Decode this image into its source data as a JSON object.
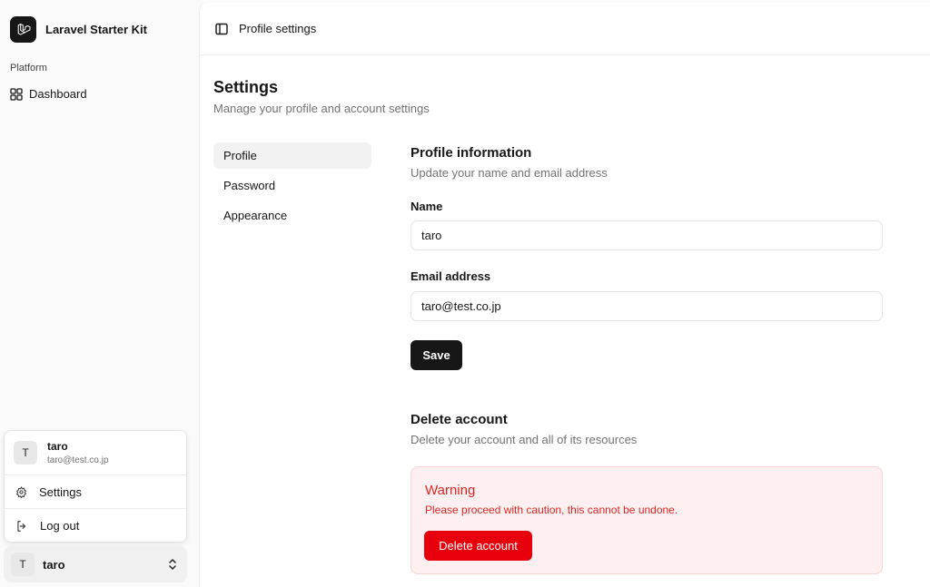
{
  "sidebar": {
    "brand": "Laravel Starter Kit",
    "group_label": "Platform",
    "nav": [
      {
        "label": "Dashboard",
        "icon": "layout-grid-icon"
      }
    ]
  },
  "user_menu": {
    "avatar_initial": "T",
    "name": "taro",
    "email": "taro@test.co.jp",
    "items": [
      {
        "label": "Settings",
        "icon": "gear-icon"
      },
      {
        "label": "Log out",
        "icon": "logout-icon"
      }
    ]
  },
  "user_trigger": {
    "avatar_initial": "T",
    "name": "taro"
  },
  "header": {
    "breadcrumb": "Profile settings"
  },
  "page": {
    "title": "Settings",
    "subtitle": "Manage your profile and account settings"
  },
  "settings_nav": [
    {
      "label": "Profile",
      "active": true
    },
    {
      "label": "Password",
      "active": false
    },
    {
      "label": "Appearance",
      "active": false
    }
  ],
  "profile": {
    "title": "Profile information",
    "subtitle": "Update your name and email address",
    "name_label": "Name",
    "name_value": "taro",
    "email_label": "Email address",
    "email_value": "taro@test.co.jp",
    "save_label": "Save"
  },
  "delete": {
    "title": "Delete account",
    "subtitle": "Delete your account and all of its resources",
    "warning_title": "Warning",
    "warning_text": "Please proceed with caution, this cannot be undone.",
    "button_label": "Delete account"
  },
  "colors": {
    "danger": "#e7000b",
    "primary": "#171717"
  }
}
